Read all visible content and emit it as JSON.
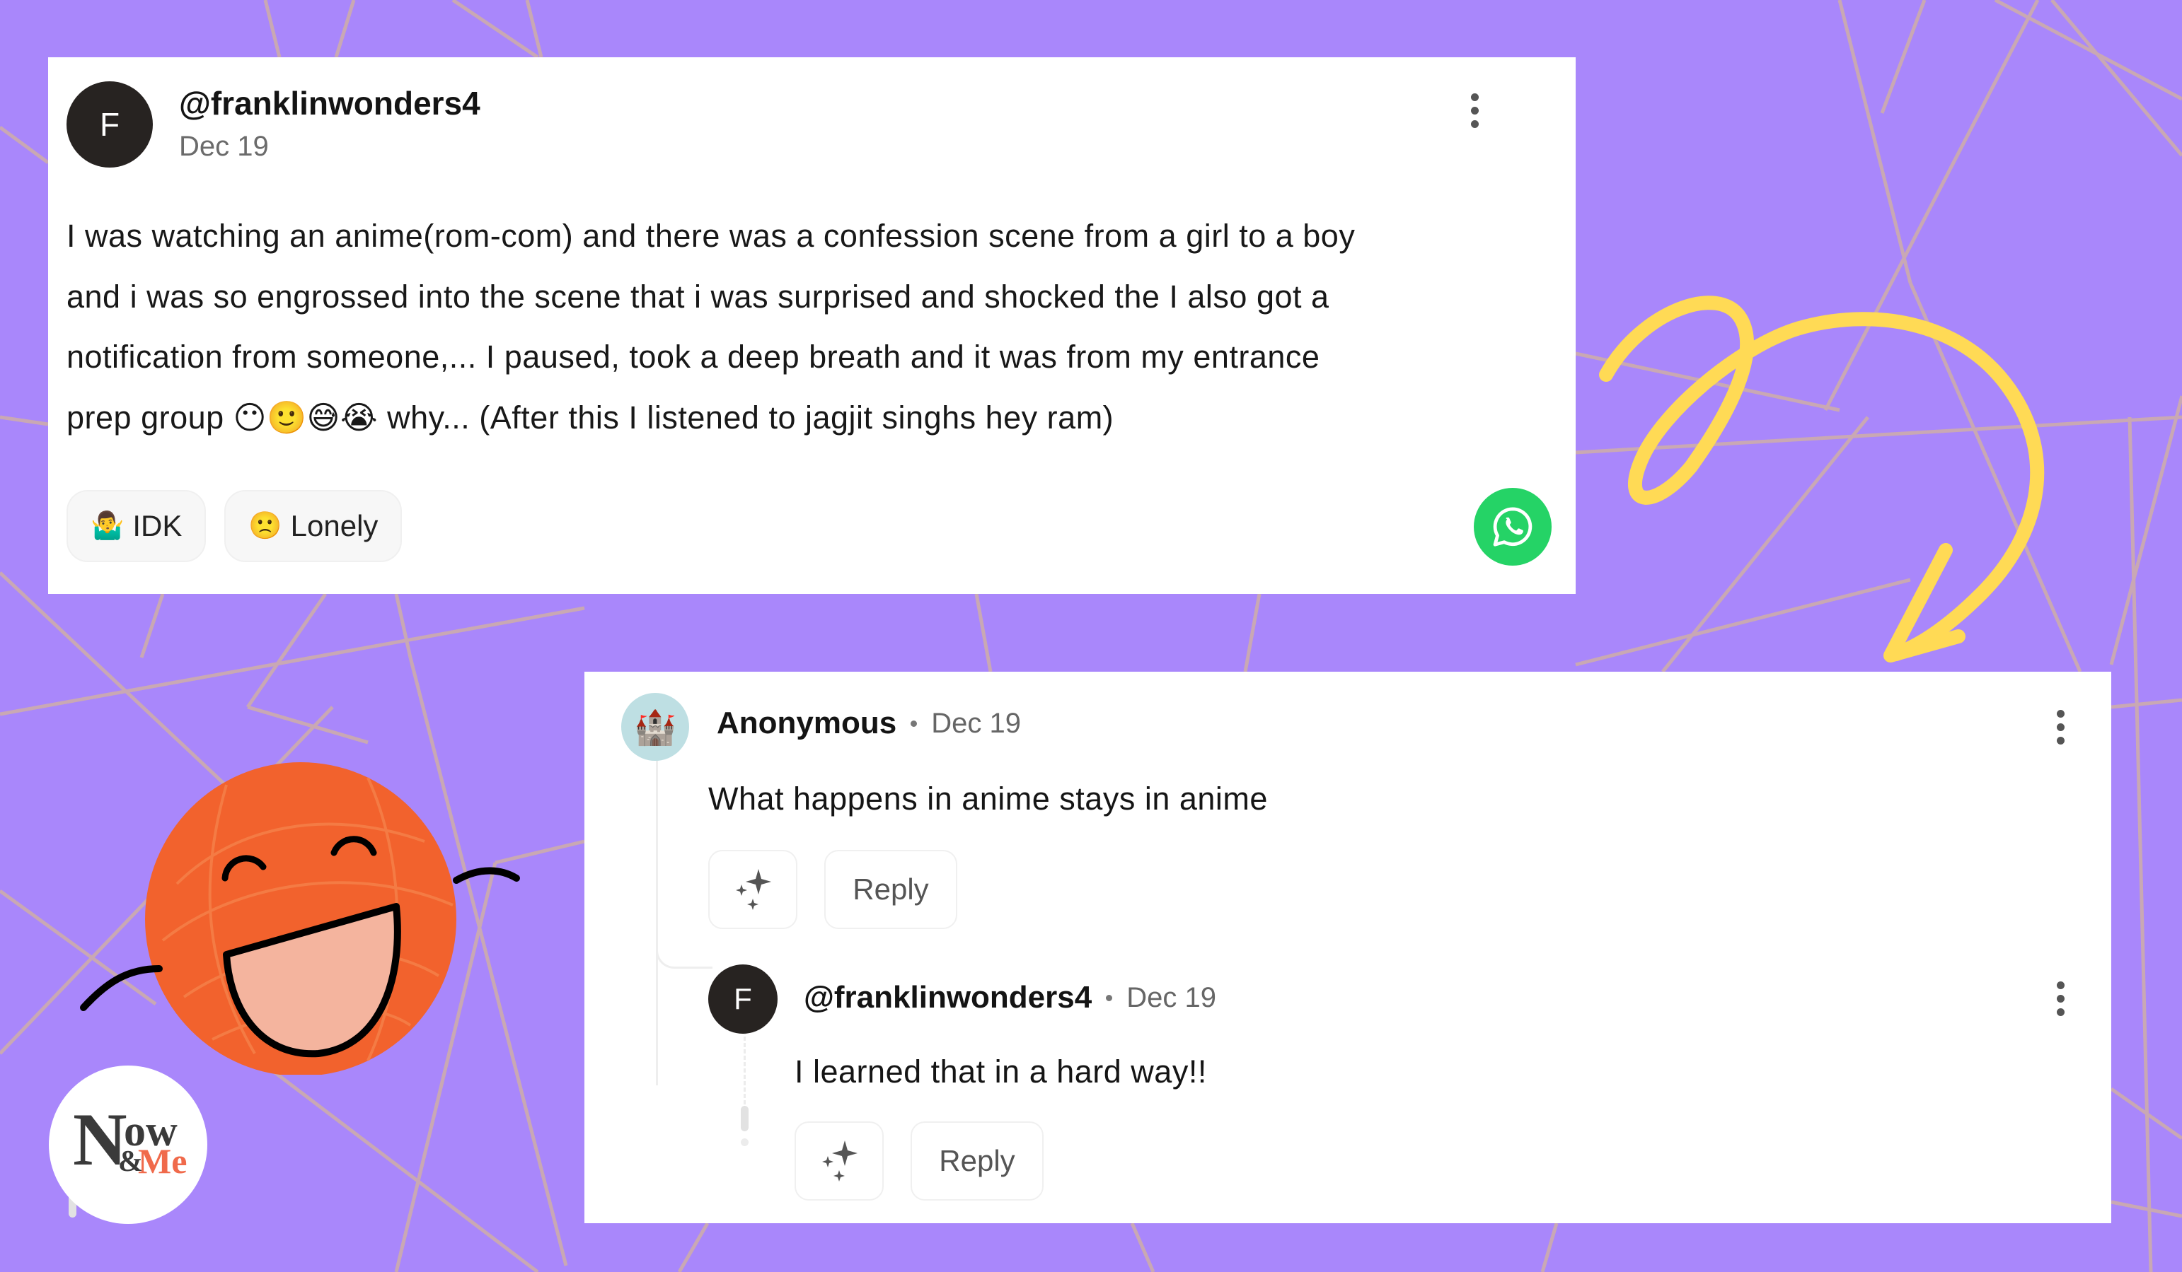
{
  "theme": {
    "background": "#A987FB",
    "line_color": "#C9A8B4",
    "accent_yellow": "#FFDA55",
    "mascot_orange": "#F2622D",
    "whatsapp_green": "#25D366",
    "brand_coral": "#F06A4B"
  },
  "post": {
    "avatar_initial": "F",
    "username": "@franklinwonders4",
    "date": "Dec 19",
    "body_lines": [
      "I was watching an anime(rom-com) and there was a confession scene from a girl to a boy",
      "and i was so engrossed into the scene that i was surprised and shocked the I also got a",
      "notification from someone,... I paused, took a deep breath and it was from my entrance",
      "prep group 😶🙂😅😭 why... (After this I listened to jagjit singhs hey ram)"
    ],
    "tags": [
      {
        "emoji": "🤷‍♂️",
        "label": "IDK"
      },
      {
        "emoji": "🙁",
        "label": "Lonely"
      }
    ],
    "share_icon": "whatsapp-icon",
    "menu_icon": "more-vertical-icon"
  },
  "comments": {
    "top": {
      "avatar_emoji": "🏰",
      "name": "Anonymous",
      "date": "Dec 19",
      "text": "What happens in anime stays in anime",
      "reply_label": "Reply",
      "react_icon": "sparkle-icon",
      "menu_icon": "more-vertical-icon"
    },
    "reply": {
      "avatar_initial": "F",
      "name": "@franklinwonders4",
      "date": "Dec 19",
      "text": "I learned that in a hard way!!",
      "reply_label": "Reply",
      "react_icon": "sparkle-icon",
      "menu_icon": "more-vertical-icon"
    }
  },
  "brand": {
    "logo_now_initial": "N",
    "logo_now_rest": "ow",
    "logo_amp": "&",
    "logo_me": "Me"
  }
}
